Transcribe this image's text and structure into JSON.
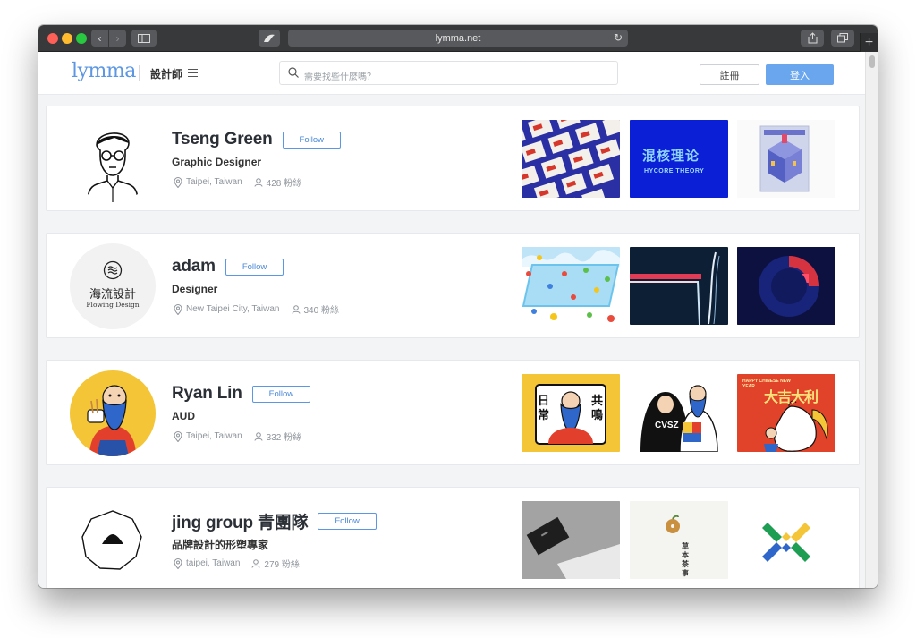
{
  "browser": {
    "url": "lymma.net"
  },
  "header": {
    "logo": "lymma",
    "nav_label": "設計師",
    "search_placeholder": "需要找些什麼嗎？",
    "register_label": "註冊",
    "login_label": "登入"
  },
  "designers": [
    {
      "name": "Tseng Green",
      "follow_label": "Follow",
      "role": "Graphic Designer",
      "location": "Taipei, Taiwan",
      "followers": "428 粉絲"
    },
    {
      "name": "adam",
      "follow_label": "Follow",
      "role": "Designer",
      "location": "New Taipei City, Taiwan",
      "followers": "340 粉絲",
      "avatar_text": "海流設計",
      "avatar_subtext": "Flowing Design"
    },
    {
      "name": "Ryan Lin",
      "follow_label": "Follow",
      "role": "AUD",
      "location": "Taipei, Taiwan",
      "followers": "332 粉絲"
    },
    {
      "name": "jing group 青團隊",
      "follow_label": "Follow",
      "role": "品牌設計的形塑專家",
      "location": "taipei, Taiwan",
      "followers": "279 粉絲"
    }
  ],
  "thumbnails": {
    "hycore_cn": "混核理论",
    "hycore_en": "HYCORE THEORY",
    "cn_poster_left": "日常",
    "cn_poster_right": "共鳴",
    "cny_title": "大吉大利",
    "cny_small": "HAPPY CHINESE NEW YEAR",
    "hoodie_text": "CVSZ",
    "tea_text": "草本茶事"
  },
  "colors": {
    "accent": "#5b97e2",
    "login_bg": "#6aa6ed",
    "hycore_blue": "#0b1fd6",
    "yellow": "#f3c537",
    "red_poster": "#e0432a"
  }
}
